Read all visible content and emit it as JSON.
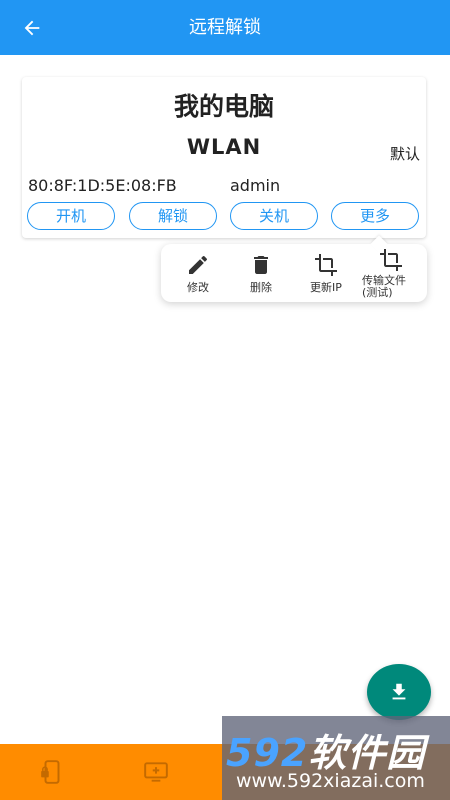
{
  "app_bar": {
    "title": "远程解锁",
    "back_icon": "arrow-left-icon",
    "color": "#2196f3"
  },
  "device_card": {
    "name": "我的电脑",
    "network_type": "WLAN",
    "default_label": "默认",
    "mac_address": "80:8F:1D:5E:08:FB",
    "username": "admin",
    "buttons": [
      {
        "label": "开机"
      },
      {
        "label": "解锁"
      },
      {
        "label": "关机"
      },
      {
        "label": "更多"
      }
    ]
  },
  "more_menu": {
    "items": [
      {
        "label": "修改",
        "icon": "pencil-icon"
      },
      {
        "label": "删除",
        "icon": "trash-icon"
      },
      {
        "label": "更新IP",
        "icon": "crop-icon"
      },
      {
        "label": "传输文件\n(测试)",
        "icon": "crop-icon"
      }
    ]
  },
  "fab": {
    "icon": "download-icon",
    "color": "#00897b"
  },
  "bottom_nav": {
    "color": "#ff8c00",
    "items": [
      {
        "icon": "phone-lock-icon"
      },
      {
        "icon": "monitor-add-icon"
      }
    ]
  },
  "watermark": {
    "brand_number": "592",
    "brand_text": "软件园",
    "url": "www.592xiazai.com"
  }
}
